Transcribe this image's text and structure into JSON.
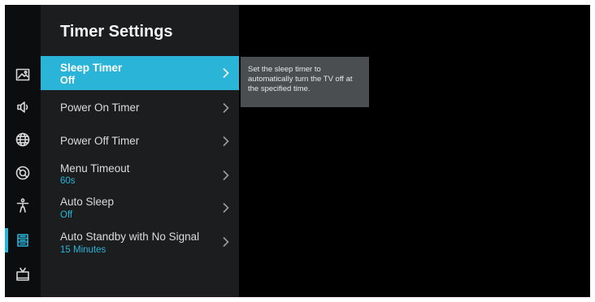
{
  "menu": {
    "title": "Timer Settings",
    "items": [
      {
        "label": "Sleep Timer",
        "value": "Off"
      },
      {
        "label": "Power On Timer"
      },
      {
        "label": "Power Off Timer"
      },
      {
        "label": "Menu Timeout",
        "value": "60s"
      },
      {
        "label": "Auto Sleep",
        "value": "Off"
      },
      {
        "label": "Auto Standby with No Signal",
        "value": "15 Minutes"
      }
    ]
  },
  "sidebar": {
    "icons": [
      "picture-icon",
      "sound-icon",
      "network-icon",
      "support-icon",
      "accessibility-icon",
      "system-icon",
      "channel-icon"
    ],
    "active_index": 5
  },
  "tooltip": {
    "text": "Set the sleep timer to automatically turn the TV off at the specified time."
  },
  "colors": {
    "accent": "#2ab4d8",
    "panel": "#1b1d1f",
    "background": "#000000",
    "tooltip": "#4b4e51"
  }
}
